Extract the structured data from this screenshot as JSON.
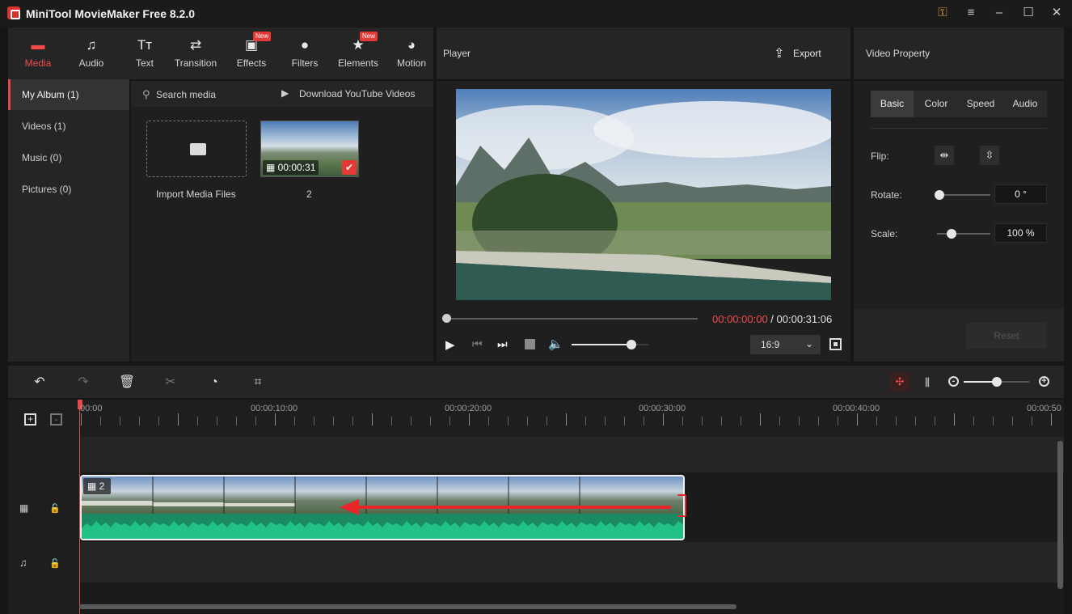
{
  "app": {
    "title": "MiniTool MovieMaker Free 8.2.0"
  },
  "toolbar": {
    "items": [
      {
        "label": "Media",
        "icon": "media-icon"
      },
      {
        "label": "Audio",
        "icon": "audio-icon"
      },
      {
        "label": "Text",
        "icon": "text-icon"
      },
      {
        "label": "Transition",
        "icon": "transition-icon"
      },
      {
        "label": "Effects",
        "icon": "effects-icon",
        "badge": "New"
      },
      {
        "label": "Filters",
        "icon": "filters-icon"
      },
      {
        "label": "Elements",
        "icon": "elements-icon",
        "badge": "New"
      },
      {
        "label": "Motion",
        "icon": "motion-icon"
      }
    ]
  },
  "library": {
    "nav": [
      "My Album (1)",
      "Videos (1)",
      "Music (0)",
      "Pictures (0)"
    ],
    "search": "Search media",
    "download": "Download YouTube Videos",
    "import_label": "Import Media Files",
    "clip": {
      "duration": "00:00:31",
      "name": "2"
    }
  },
  "player": {
    "title": "Player",
    "export": "Export",
    "current": "00:00:00:00",
    "separator": " / ",
    "total": "00:00:31:06",
    "ratio": "16:9",
    "volume": 0.78,
    "progress": 0.0
  },
  "property": {
    "title": "Video Property",
    "tabs": [
      "Basic",
      "Color",
      "Speed",
      "Audio"
    ],
    "active_tab": "Basic",
    "flip": "Flip:",
    "rotate": "Rotate:",
    "rotate_value": "0 °",
    "scale": "Scale:",
    "scale_value": "100 %",
    "reset": "Reset",
    "rotate_level": 0.0,
    "scale_level": 0.25
  },
  "timeline": {
    "ruler": [
      "00:00",
      "00:00:10:00",
      "00:00:20:00",
      "00:00:30:00",
      "00:00:40:00",
      "00:00:50"
    ],
    "clip_label": "2",
    "zoom": 0.5
  },
  "colors": {
    "accent": "#ef4b4b",
    "audio_wave": "#1fb37d",
    "panel": "#252525"
  }
}
